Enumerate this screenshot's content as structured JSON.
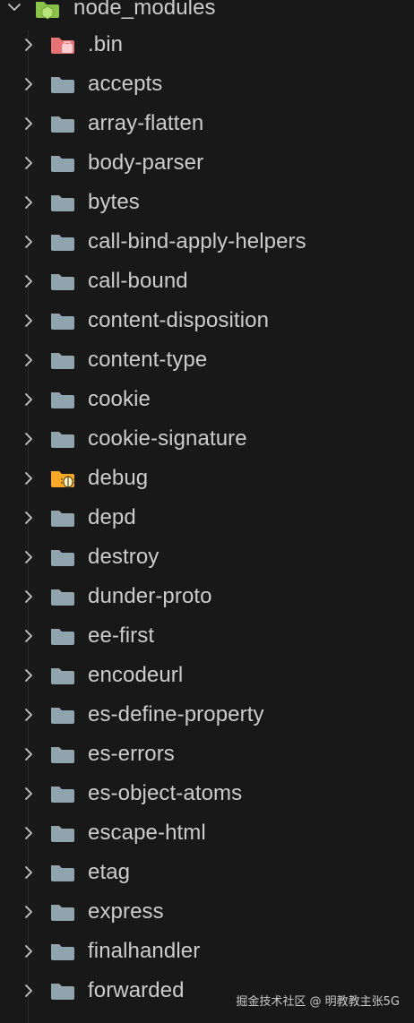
{
  "explorer": {
    "root": {
      "label": "node_modules",
      "expanded": true,
      "icon": "folder-open-node-icon",
      "icon_color": "#8bc34a"
    },
    "items": [
      {
        "label": ".bin",
        "icon": "folder-bin-icon",
        "color": "#e57373"
      },
      {
        "label": "accepts",
        "icon": "folder-icon",
        "color": "#90a4ae"
      },
      {
        "label": "array-flatten",
        "icon": "folder-icon",
        "color": "#90a4ae"
      },
      {
        "label": "body-parser",
        "icon": "folder-icon",
        "color": "#90a4ae"
      },
      {
        "label": "bytes",
        "icon": "folder-icon",
        "color": "#90a4ae"
      },
      {
        "label": "call-bind-apply-helpers",
        "icon": "folder-icon",
        "color": "#90a4ae"
      },
      {
        "label": "call-bound",
        "icon": "folder-icon",
        "color": "#90a4ae"
      },
      {
        "label": "content-disposition",
        "icon": "folder-icon",
        "color": "#90a4ae"
      },
      {
        "label": "content-type",
        "icon": "folder-icon",
        "color": "#90a4ae"
      },
      {
        "label": "cookie",
        "icon": "folder-icon",
        "color": "#90a4ae"
      },
      {
        "label": "cookie-signature",
        "icon": "folder-icon",
        "color": "#90a4ae"
      },
      {
        "label": "debug",
        "icon": "folder-debug-icon",
        "color": "#f9a825"
      },
      {
        "label": "depd",
        "icon": "folder-icon",
        "color": "#90a4ae"
      },
      {
        "label": "destroy",
        "icon": "folder-icon",
        "color": "#90a4ae"
      },
      {
        "label": "dunder-proto",
        "icon": "folder-icon",
        "color": "#90a4ae"
      },
      {
        "label": "ee-first",
        "icon": "folder-icon",
        "color": "#90a4ae"
      },
      {
        "label": "encodeurl",
        "icon": "folder-icon",
        "color": "#90a4ae"
      },
      {
        "label": "es-define-property",
        "icon": "folder-icon",
        "color": "#90a4ae"
      },
      {
        "label": "es-errors",
        "icon": "folder-icon",
        "color": "#90a4ae"
      },
      {
        "label": "es-object-atoms",
        "icon": "folder-icon",
        "color": "#90a4ae"
      },
      {
        "label": "escape-html",
        "icon": "folder-icon",
        "color": "#90a4ae"
      },
      {
        "label": "etag",
        "icon": "folder-icon",
        "color": "#90a4ae"
      },
      {
        "label": "express",
        "icon": "folder-icon",
        "color": "#90a4ae"
      },
      {
        "label": "finalhandler",
        "icon": "folder-icon",
        "color": "#90a4ae"
      },
      {
        "label": "forwarded",
        "icon": "folder-icon",
        "color": "#90a4ae"
      }
    ]
  },
  "watermark": "掘金技术社区 @ 明教教主张5G",
  "colors": {
    "background": "#181818",
    "text": "#cccccc",
    "chevron": "#c5c5c5"
  }
}
